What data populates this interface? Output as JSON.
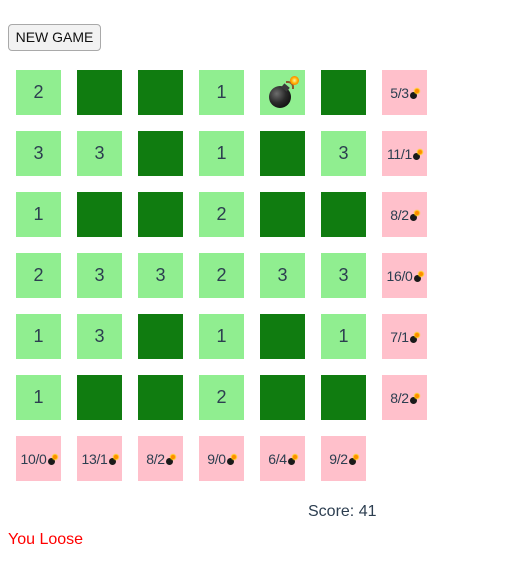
{
  "new_game_label": "NEW GAME",
  "board": {
    "rows": [
      [
        {
          "state": "revealed",
          "value": "2"
        },
        {
          "state": "hidden",
          "value": ""
        },
        {
          "state": "hidden",
          "value": ""
        },
        {
          "state": "revealed",
          "value": "1"
        },
        {
          "state": "mine",
          "value": ""
        },
        {
          "state": "hidden",
          "value": ""
        }
      ],
      [
        {
          "state": "revealed",
          "value": "3"
        },
        {
          "state": "revealed",
          "value": "3"
        },
        {
          "state": "hidden",
          "value": ""
        },
        {
          "state": "revealed",
          "value": "1"
        },
        {
          "state": "hidden",
          "value": ""
        },
        {
          "state": "revealed",
          "value": "3"
        }
      ],
      [
        {
          "state": "revealed",
          "value": "1"
        },
        {
          "state": "hidden",
          "value": ""
        },
        {
          "state": "hidden",
          "value": ""
        },
        {
          "state": "revealed",
          "value": "2"
        },
        {
          "state": "hidden",
          "value": ""
        },
        {
          "state": "hidden",
          "value": ""
        }
      ],
      [
        {
          "state": "revealed",
          "value": "2"
        },
        {
          "state": "revealed",
          "value": "3"
        },
        {
          "state": "revealed",
          "value": "3"
        },
        {
          "state": "revealed",
          "value": "2"
        },
        {
          "state": "revealed",
          "value": "3"
        },
        {
          "state": "revealed",
          "value": "3"
        }
      ],
      [
        {
          "state": "revealed",
          "value": "1"
        },
        {
          "state": "revealed",
          "value": "3"
        },
        {
          "state": "hidden",
          "value": ""
        },
        {
          "state": "revealed",
          "value": "1"
        },
        {
          "state": "hidden",
          "value": ""
        },
        {
          "state": "revealed",
          "value": "1"
        }
      ],
      [
        {
          "state": "revealed",
          "value": "1"
        },
        {
          "state": "hidden",
          "value": ""
        },
        {
          "state": "hidden",
          "value": ""
        },
        {
          "state": "revealed",
          "value": "2"
        },
        {
          "state": "hidden",
          "value": ""
        },
        {
          "state": "hidden",
          "value": ""
        }
      ]
    ],
    "row_hints": [
      "5/3",
      "11/1",
      "8/2",
      "16/0",
      "7/1",
      "8/2"
    ],
    "col_hints": [
      "10/0",
      "13/1",
      "8/2",
      "9/0",
      "6/4",
      "9/2"
    ]
  },
  "score_text": "Score: 41",
  "status_text": "You Loose",
  "colors": {
    "revealed": "#90ee90",
    "hidden": "#107c10",
    "hint": "#ffc0cb",
    "status": "#ff0000"
  },
  "icons": {
    "mine": "bomb-icon",
    "hint_marker": "bomb-icon"
  }
}
